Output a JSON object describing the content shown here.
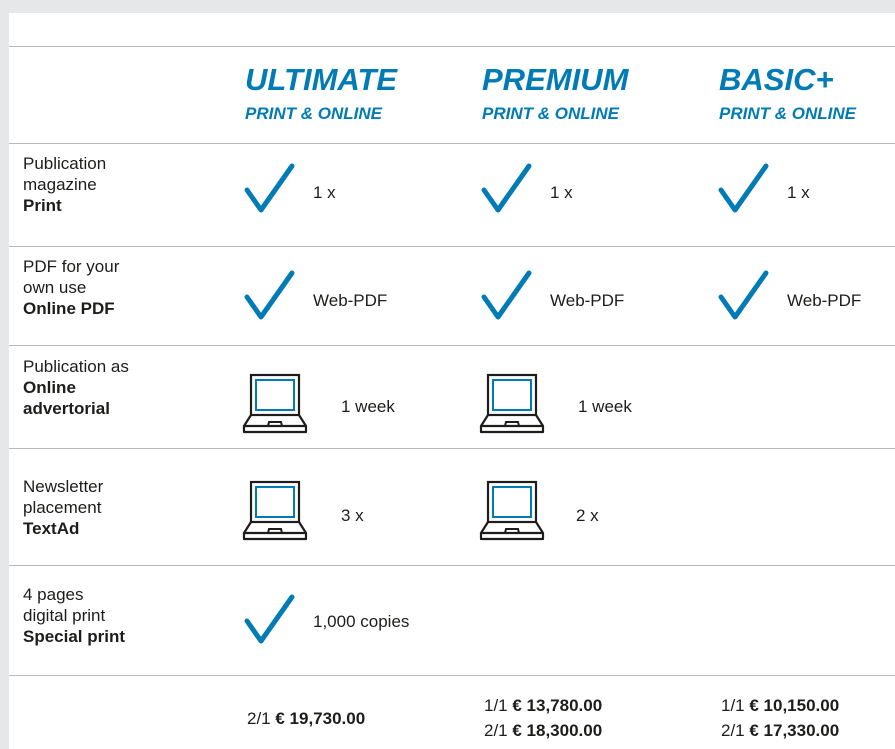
{
  "plans": [
    {
      "name": "ULTIMATE",
      "sub": "PRINT & ONLINE"
    },
    {
      "name": "PREMIUM",
      "sub": "PRINT & ONLINE"
    },
    {
      "name": "BASIC+",
      "sub": "PRINT & ONLINE"
    }
  ],
  "rows": [
    {
      "label_lines": [
        "Publication",
        "magazine"
      ],
      "label_bold": [
        "Print"
      ],
      "cells": [
        {
          "icon": "checkmark-icon",
          "text": "1 x"
        },
        {
          "icon": "checkmark-icon",
          "text": "1 x"
        },
        {
          "icon": "checkmark-icon",
          "text": "1 x"
        }
      ]
    },
    {
      "label_lines": [
        "PDF for your",
        "own use"
      ],
      "label_bold": [
        "Online PDF"
      ],
      "cells": [
        {
          "icon": "checkmark-icon",
          "text": "Web-PDF"
        },
        {
          "icon": "checkmark-icon",
          "text": "Web-PDF"
        },
        {
          "icon": "checkmark-icon",
          "text": "Web-PDF"
        }
      ]
    },
    {
      "label_lines": [
        "Publication as"
      ],
      "label_bold": [
        "Online",
        "advertorial"
      ],
      "cells": [
        {
          "icon": "laptop-icon",
          "text": "1 week"
        },
        {
          "icon": "laptop-icon",
          "text": "1 week"
        }
      ]
    },
    {
      "label_lines": [
        "Newsletter",
        "placement"
      ],
      "label_bold": [
        "TextAd"
      ],
      "cells": [
        {
          "icon": "laptop-icon",
          "text": "3 x"
        },
        {
          "icon": "laptop-icon",
          "text": "2 x"
        }
      ]
    },
    {
      "label_lines": [
        "4 pages",
        "digital print"
      ],
      "label_bold": [
        "Special print"
      ],
      "cells": [
        {
          "icon": "checkmark-icon",
          "text": "1,000 copies"
        }
      ]
    }
  ],
  "prices": [
    [
      {
        "format": "2/1",
        "amount": "€ 19,730.00"
      }
    ],
    [
      {
        "format": "1/1",
        "amount": "€ 13,780.00"
      },
      {
        "format": "2/1",
        "amount": "€ 18,300.00"
      }
    ],
    [
      {
        "format": "1/1",
        "amount": "€ 10,150.00"
      },
      {
        "format": "2/1",
        "amount": "€ 17,330.00"
      }
    ]
  ],
  "colors": {
    "accent": "#007bb5",
    "laptop": "#1d1d1b",
    "rule": "#b9babc",
    "background": "#e6e7e9"
  }
}
